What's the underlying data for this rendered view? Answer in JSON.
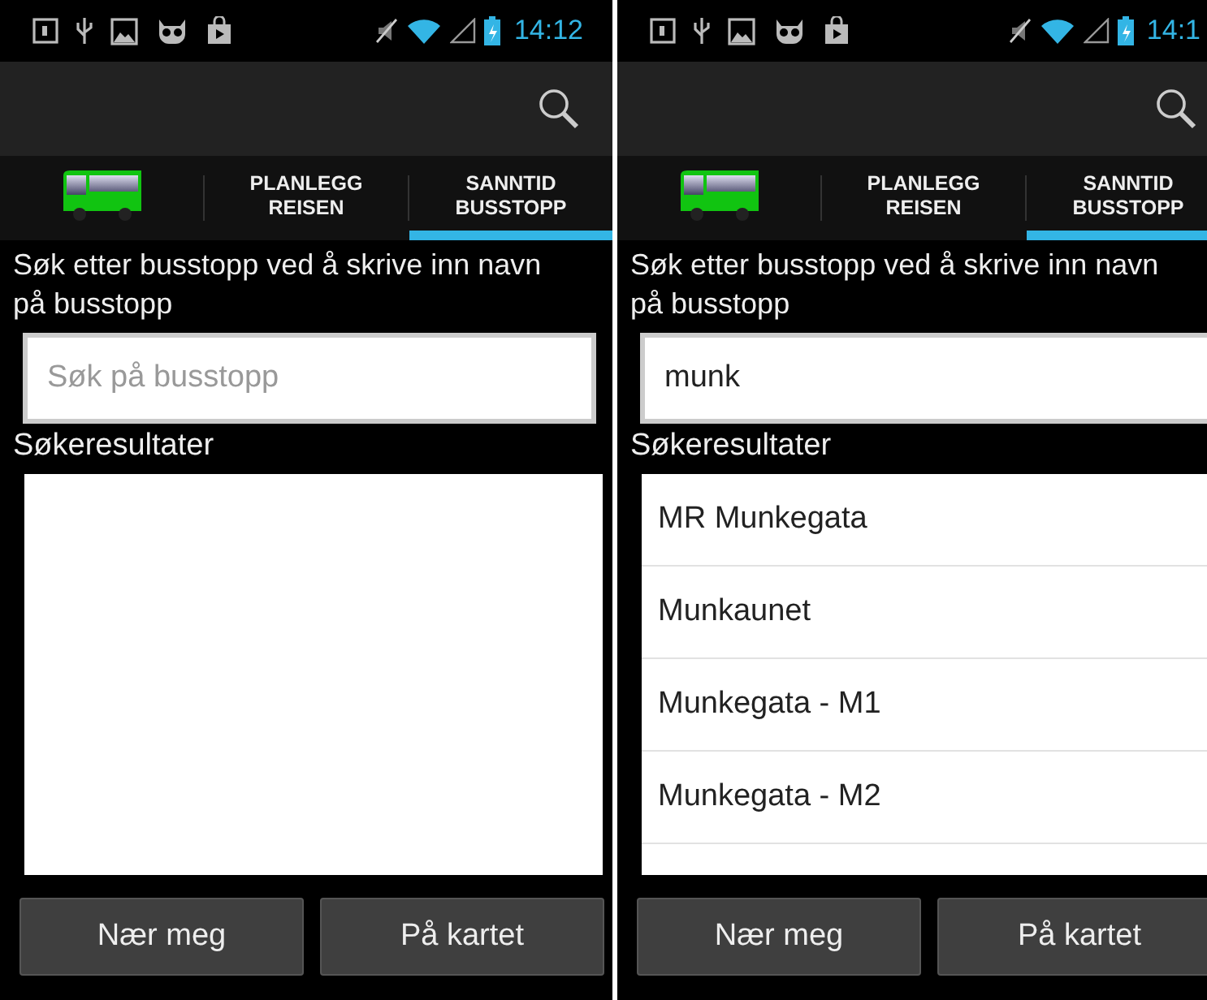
{
  "screens": [
    {
      "status_bar": {
        "time": "14:12"
      },
      "tabs": [
        {
          "kind": "icon",
          "selected": false
        },
        {
          "kind": "text",
          "lines": [
            "PLANLEGG",
            "REISEN"
          ],
          "selected": false
        },
        {
          "kind": "text",
          "lines": [
            "SANNTID",
            "BUSSTOPP"
          ],
          "selected": true
        }
      ],
      "prompt": "Søk etter busstopp ved å skrive inn navn på busstopp",
      "search": {
        "placeholder": "Søk på busstopp"
      },
      "results_label": "Søkeresultater",
      "buttons": [
        "Nær meg",
        "På kartet"
      ]
    },
    {
      "status_bar": {
        "time": "14:1"
      },
      "tabs": [
        {
          "kind": "icon",
          "selected": false
        },
        {
          "kind": "text",
          "lines": [
            "PLANLEGG",
            "REISEN"
          ],
          "selected": false
        },
        {
          "kind": "text",
          "lines": [
            "SANNTID",
            "BUSSTOPP"
          ],
          "selected": true
        }
      ],
      "prompt": "Søk etter busstopp ved å skrive inn navn på busstopp",
      "search": {
        "value": "munk"
      },
      "results_label": "Søkeresultater",
      "results": [
        "MR Munkegata",
        "Munkaunet",
        "Munkegata - M1",
        "Munkegata - M2"
      ],
      "buttons": [
        "Nær meg",
        "På kartet"
      ]
    }
  ]
}
